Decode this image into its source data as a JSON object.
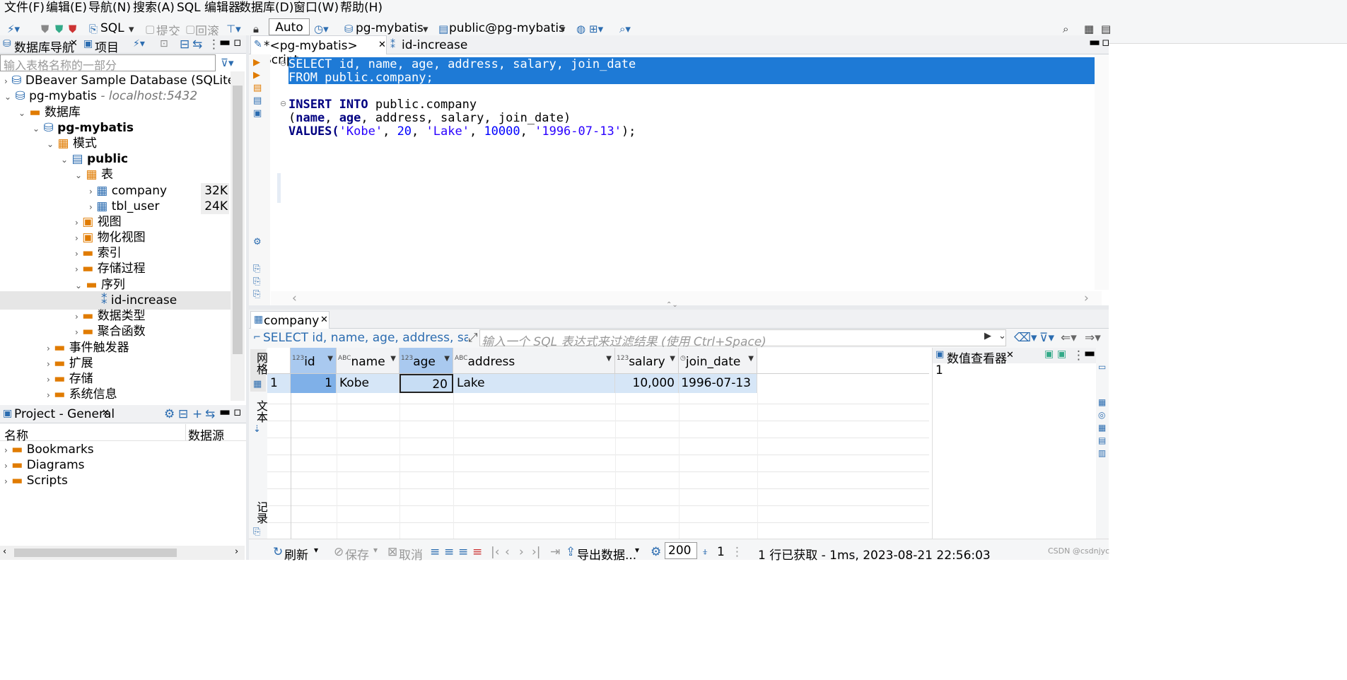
{
  "menu": [
    "文件(F)",
    "编辑(E)",
    "导航(N)",
    "搜索(A)",
    "SQL 编辑器",
    "数据库(D)",
    "窗口(W)",
    "帮助(H)"
  ],
  "toolbar": {
    "sql": "SQL",
    "commit": "提交",
    "rollback": "回滚",
    "auto": "Auto",
    "datasource": "pg-mybatis",
    "schema": "public@pg-mybatis"
  },
  "left": {
    "tab_nav": "数据库导航",
    "tab_project": "项目",
    "filter_placeholder": "输入表格名称的一部分",
    "tree": {
      "sample_db": "DBeaver Sample Database (SQLite)",
      "pg": "pg-mybatis",
      "pg_host": "- localhost:5432",
      "databases": "数据库",
      "db": "pg-mybatis",
      "schemas": "模式",
      "public": "public",
      "tables": "表",
      "company": "company",
      "company_size": "32K",
      "tbl_user": "tbl_user",
      "tbl_user_size": "24K",
      "views": "视图",
      "matviews": "物化视图",
      "indexes": "索引",
      "procedures": "存储过程",
      "sequences": "序列",
      "id_increase": "id-increase",
      "datatypes": "数据类型",
      "aggregates": "聚合函数",
      "triggers": "事件触发器",
      "extensions": "扩展",
      "storage": "存储",
      "sysinfo": "系统信息"
    },
    "project": {
      "title": "Project - General",
      "col_name": "名称",
      "col_source": "数据源",
      "items": [
        "Bookmarks",
        "Diagrams",
        "Scripts"
      ]
    }
  },
  "editor": {
    "tab1": "*<pg-mybatis> Script",
    "tab2": "id-increase",
    "lines": {
      "l1": "SELECT id, name, age, address, salary, join_date",
      "l2": "FROM public.company;",
      "l3a": "INSERT INTO",
      "l3b": " public.company",
      "l4a": "(",
      "l4b": "name",
      "l4c": ", ",
      "l4d": "age",
      "l4e": ", address, salary, join_date)",
      "l5a": "VALUES(",
      "l5b": "'Kobe'",
      "l5c": ", ",
      "l5d": "20",
      "l5e": ", ",
      "l5f": "'Lake'",
      "l5g": ", ",
      "l5h": "10000",
      "l5i": ", ",
      "l5j": "'1996-07-13'",
      "l5k": ");"
    }
  },
  "results": {
    "tab": "company 1",
    "query": "SELECT id, name, age, address, salary, joi",
    "filter_placeholder": "输入一个 SQL 表达式来过滤结果 (使用 Ctrl+Space)",
    "side_grid": "网格",
    "side_text": "文本",
    "side_record": "记录",
    "columns": [
      {
        "type": "123",
        "name": "id"
      },
      {
        "type": "ABC",
        "name": "name"
      },
      {
        "type": "123",
        "name": "age"
      },
      {
        "type": "ABC",
        "name": "address"
      },
      {
        "type": "123",
        "name": "salary"
      },
      {
        "type": "◷",
        "name": "join_date"
      }
    ],
    "row": {
      "num": "1",
      "id": "1",
      "name": "Kobe",
      "age": "20",
      "address": "Lake",
      "salary": "10,000",
      "join_date": "1996-07-13"
    },
    "viewer_title": "数值查看器",
    "viewer_value": "1"
  },
  "status": {
    "refresh": "刷新",
    "save": "保存",
    "cancel": "取消",
    "export": "导出数据...",
    "limit": "200",
    "count": "1",
    "message": "1 行已获取 - 1ms, 2023-08-21 22:56:03",
    "watermark": "CSDN @csdnjyc"
  }
}
